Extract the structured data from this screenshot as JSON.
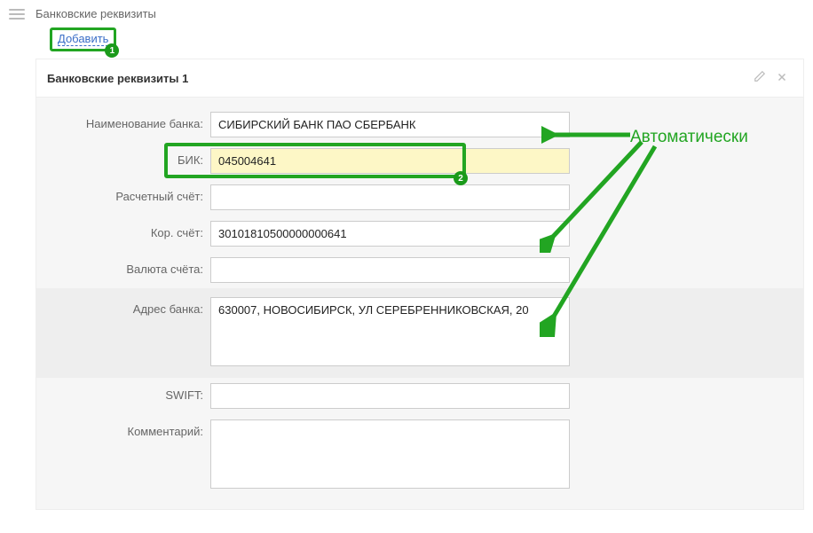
{
  "page": {
    "title": "Банковские реквизиты",
    "add_link": "Добавить"
  },
  "panel": {
    "title": "Банковские реквизиты 1"
  },
  "annotations": {
    "badge1": "1",
    "badge2": "2",
    "auto": "Автоматически"
  },
  "labels": {
    "bank_name": "Наименование банка:",
    "bik": "БИК:",
    "settlement_account": "Расчетный счёт:",
    "corr_account": "Кор. счёт:",
    "currency": "Валюта счёта:",
    "bank_address": "Адрес банка:",
    "swift": "SWIFT:",
    "comment": "Комментарий:"
  },
  "values": {
    "bank_name": "СИБИРСКИЙ БАНК ПАО СБЕРБАНК",
    "bik": "045004641",
    "settlement_account": "",
    "corr_account": "30101810500000000641",
    "currency": "",
    "bank_address": "630007, НОВОСИБИРСК, УЛ СЕРЕБРЕННИКОВСКАЯ, 20",
    "swift": "",
    "comment": ""
  }
}
